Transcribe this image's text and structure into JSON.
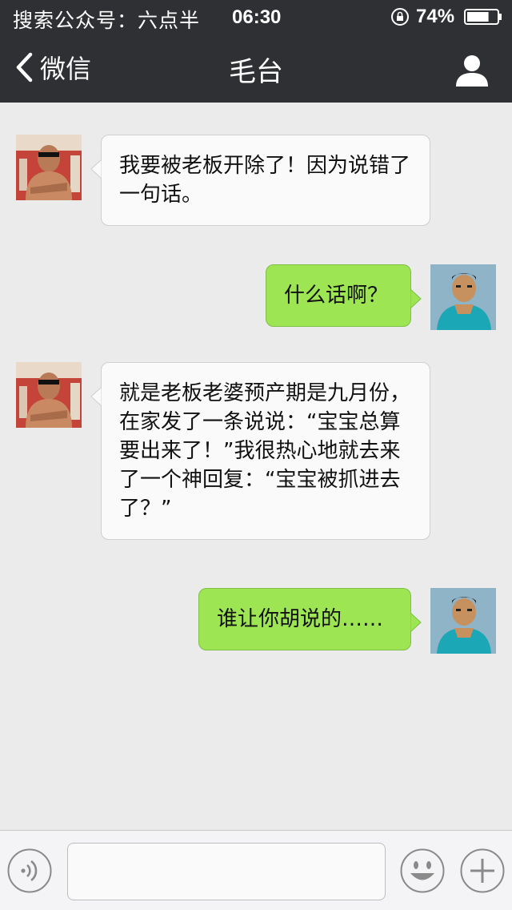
{
  "status_bar": {
    "carrier": "搜索公众号：六点半",
    "time": "06:30",
    "battery_percent": "74%",
    "battery_level": 0.74
  },
  "nav": {
    "back_label": "微信",
    "title": "毛台",
    "back_icon": "chevron-left-icon",
    "profile_icon": "person-icon"
  },
  "messages": [
    {
      "side": "left",
      "text": "我要被老板开除了！因为说错了一句话。"
    },
    {
      "side": "right",
      "text": "什么话啊？"
    },
    {
      "side": "left",
      "text": "就是老板老婆预产期是九月份，在家发了一条说说：“宝宝总算要出来了！”我很热心地就去来了一个神回复：“宝宝被抓进去了？”"
    },
    {
      "side": "right",
      "text": "谁让你胡说的……"
    }
  ],
  "input_bar": {
    "voice_icon": "voice-icon",
    "emoji_icon": "emoji-icon",
    "plus_icon": "plus-icon",
    "input_value": ""
  },
  "colors": {
    "header_bg": "#2f3033",
    "chat_bg": "#ebebeb",
    "my_bubble": "#9ee554",
    "their_bubble": "#fafafa"
  }
}
